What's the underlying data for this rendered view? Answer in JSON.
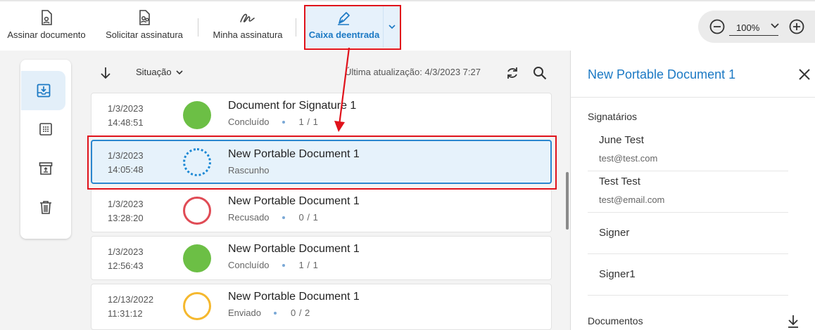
{
  "toolbar": {
    "sign_document": "Assinar documento",
    "request_signature": "Solicitar assinatura",
    "my_signature": "Minha assinatura",
    "inbox": "Caixa deentrada"
  },
  "zoom": {
    "value": "100%"
  },
  "list": {
    "status_filter": "Situação",
    "last_update": "Última atualização: 4/3/2023 7:27",
    "rows": [
      {
        "date": "1/3/2023",
        "time": "14:48:51",
        "title": "Document for Signature 1",
        "status": "Concluído",
        "count": "1 / 1",
        "state_color": "#6cbf45"
      },
      {
        "date": "1/3/2023",
        "time": "14:05:48",
        "title": "New Portable Document 1",
        "status": "Rascunho",
        "count": "",
        "state_color": "#1b88d4"
      },
      {
        "date": "1/3/2023",
        "time": "13:28:20",
        "title": "New Portable Document 1",
        "status": "Recusado",
        "count": "0 / 1",
        "state_color": "#e04b55"
      },
      {
        "date": "1/3/2023",
        "time": "12:56:43",
        "title": "New Portable Document 1",
        "status": "Concluído",
        "count": "1 / 1",
        "state_color": "#6cbf45"
      },
      {
        "date": "12/13/2022",
        "time": "11:31:12",
        "title": "New Portable Document 1",
        "status": "Enviado",
        "count": "0 / 2",
        "state_color": "#f5b82e"
      }
    ]
  },
  "panel": {
    "title": "New Portable Document 1",
    "signatories_label": "Signatários",
    "signers": [
      {
        "name": "June Test",
        "email": "test@test.com"
      },
      {
        "name": "Test Test",
        "email": "test@email.com"
      },
      {
        "name": "Signer",
        "email": ""
      },
      {
        "name": "Signer1",
        "email": ""
      }
    ],
    "documents_label": "Documentos"
  },
  "colors": {
    "accent": "#1b79c4",
    "highlight": "#e0121b"
  }
}
